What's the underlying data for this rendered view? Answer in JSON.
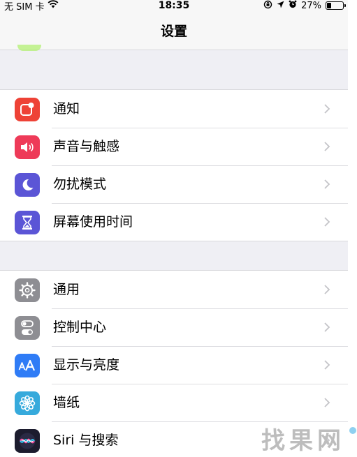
{
  "status_bar": {
    "carrier": "无 SIM 卡",
    "time": "18:35",
    "battery_percent": "27%",
    "battery_level": 0.27,
    "icons": [
      "wifi-icon",
      "lock-rotation-icon",
      "location-icon",
      "alarm-icon",
      "battery-icon"
    ]
  },
  "nav": {
    "title": "设置"
  },
  "groups": [
    {
      "items": [
        {
          "label": "通知",
          "icon": "notifications-icon",
          "color": "#ee4236"
        },
        {
          "label": "声音与触感",
          "icon": "speaker-icon",
          "color": "#ee3a58"
        },
        {
          "label": "勿扰模式",
          "icon": "moon-icon",
          "color": "#5b55d6"
        },
        {
          "label": "屏幕使用时间",
          "icon": "hourglass-icon",
          "color": "#5b55d6"
        }
      ]
    },
    {
      "items": [
        {
          "label": "通用",
          "icon": "gear-icon",
          "color": "#8e8e93"
        },
        {
          "label": "控制中心",
          "icon": "toggles-icon",
          "color": "#8e8e93"
        },
        {
          "label": "显示与亮度",
          "icon": "text-size-icon",
          "color": "#2f7cf6"
        },
        {
          "label": "墙纸",
          "icon": "flower-icon",
          "color": "#36aadc"
        },
        {
          "label": "Siri 与搜索",
          "icon": "siri-icon",
          "color": "#1c1c2e"
        }
      ]
    }
  ],
  "watermark": {
    "text": "找果网"
  }
}
